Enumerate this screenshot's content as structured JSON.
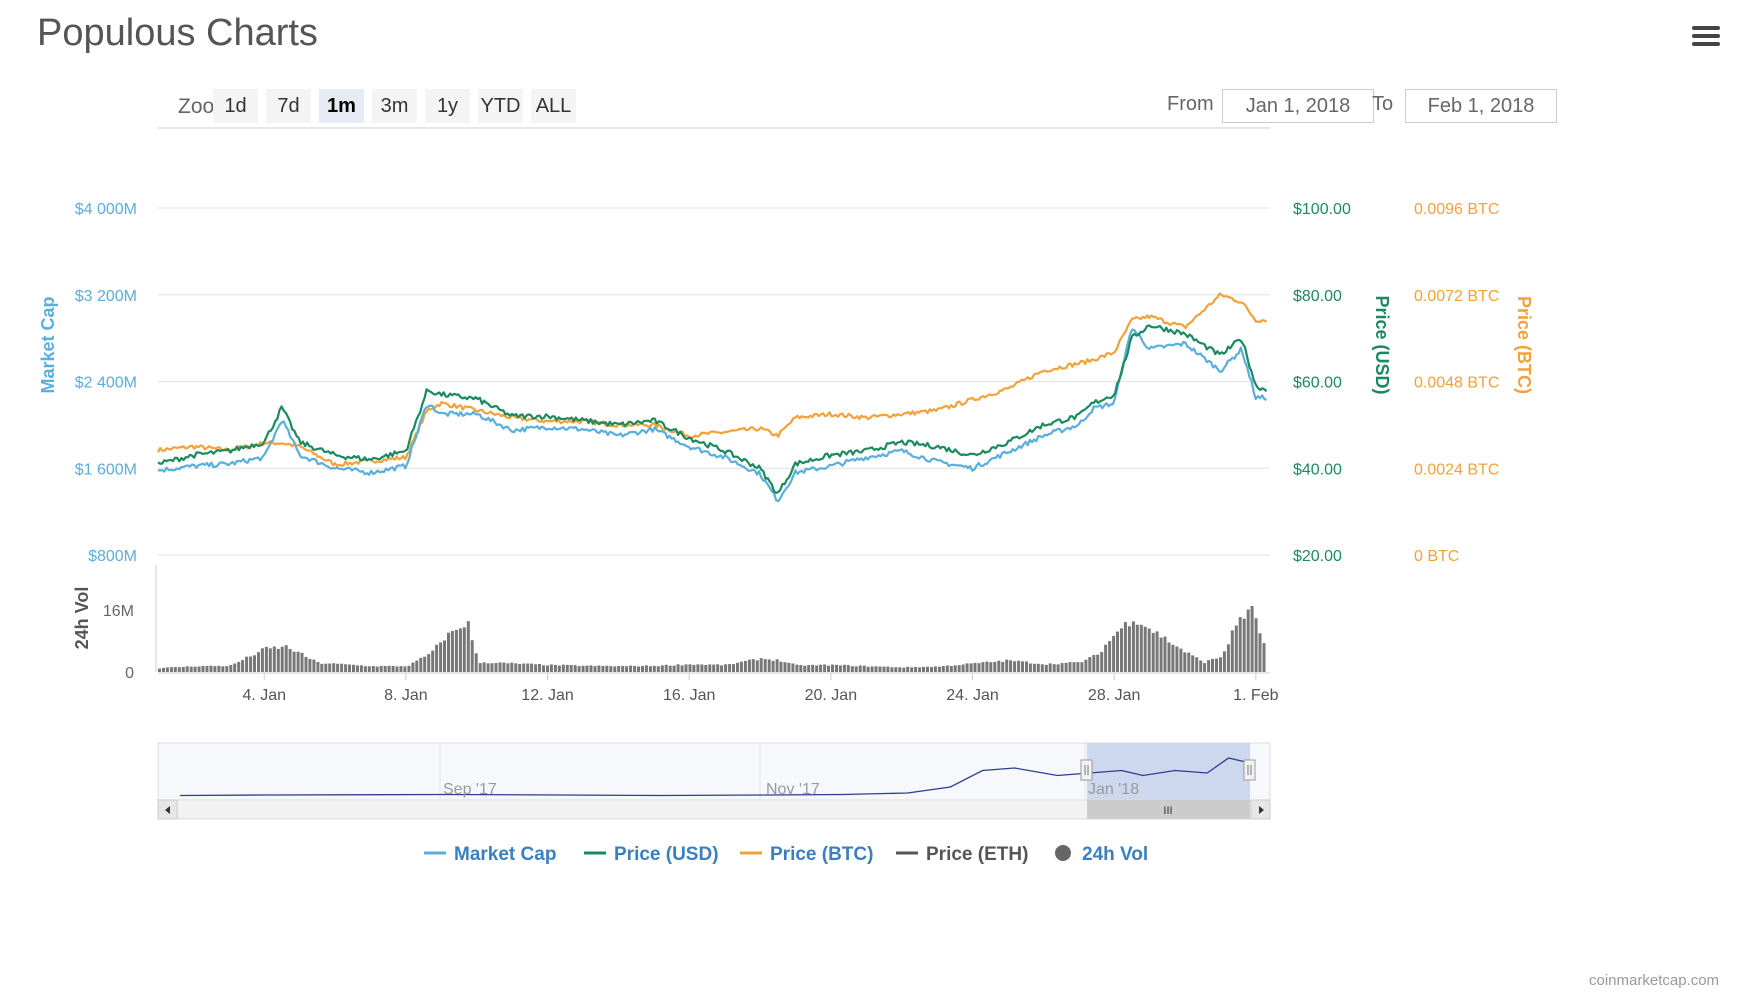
{
  "header": {
    "title": "Populous Charts",
    "menu_icon": "hamburger-icon"
  },
  "zoom": {
    "label": "Zoom",
    "buttons": [
      "1d",
      "7d",
      "1m",
      "3m",
      "1y",
      "YTD",
      "ALL"
    ],
    "active": "1m"
  },
  "range": {
    "from_label": "From",
    "from_value": "Jan 1, 2018",
    "to_label": "To",
    "to_value": "Feb 1, 2018"
  },
  "colors": {
    "market_cap": "#5aaedc",
    "price_usd": "#1b8a5f",
    "price_btc": "#f3a23a",
    "price_eth": "#555555",
    "volume": "#777777",
    "navigator_line": "#2c3e8f",
    "navigator_window": "#c8d3ec"
  },
  "credits": "coinmarketcap.com",
  "chart_data": {
    "type": "line",
    "x_range": [
      "2018-01-01",
      "2018-02-01"
    ],
    "x_ticks": [
      "4. Jan",
      "8. Jan",
      "12. Jan",
      "16. Jan",
      "20. Jan",
      "24. Jan",
      "28. Jan",
      "1. Feb"
    ],
    "x_tick_days": [
      3,
      7,
      11,
      15,
      19,
      23,
      27,
      31
    ],
    "grid": true,
    "legend_placement": "bottom-center",
    "axes": {
      "market_cap": {
        "title": "Market Cap",
        "ylim": [
          800,
          4000
        ],
        "unit": "M USD",
        "ticks": [
          "$800M",
          "$1 600M",
          "$2 400M",
          "$3 200M",
          "$4 000M"
        ]
      },
      "price_usd": {
        "title": "Price (USD)",
        "ylim": [
          20,
          100
        ],
        "ticks": [
          "$20.00",
          "$40.00",
          "$60.00",
          "$80.00",
          "$100.00"
        ]
      },
      "price_btc": {
        "title": "Price (BTC)",
        "ylim": [
          0,
          0.0096
        ],
        "ticks": [
          "0 BTC",
          "0.0024 BTC",
          "0.0048 BTC",
          "0.0072 BTC",
          "0.0096 BTC"
        ]
      },
      "volume": {
        "title": "24h Vol",
        "ylim": [
          0,
          16
        ],
        "unit": "M",
        "ticks": [
          "0",
          "16M"
        ]
      }
    },
    "series": [
      {
        "name": "Market Cap",
        "axis": "market_cap",
        "x": [
          0,
          1,
          2,
          3,
          3.5,
          4,
          5,
          6,
          7,
          7.6,
          8,
          9,
          10,
          11,
          12,
          13,
          14,
          15,
          16,
          17,
          17.5,
          18,
          19,
          20,
          21,
          22,
          23,
          24,
          25,
          26,
          26.4,
          27,
          27.5,
          28,
          29,
          30,
          30.6,
          31,
          31.3
        ],
        "values": [
          1580,
          1620,
          1640,
          1700,
          2050,
          1720,
          1600,
          1560,
          1620,
          2200,
          2100,
          2100,
          1950,
          1980,
          1960,
          1900,
          1960,
          1800,
          1700,
          1550,
          1300,
          1560,
          1620,
          1700,
          1760,
          1660,
          1600,
          1750,
          1900,
          2000,
          2150,
          2200,
          2900,
          2700,
          2750,
          2500,
          2700,
          2250,
          2250
        ]
      },
      {
        "name": "Price (USD)",
        "axis": "price_usd",
        "x": [
          0,
          1,
          2,
          3,
          3.5,
          4,
          5,
          6,
          7,
          7.6,
          8,
          9,
          10,
          11,
          12,
          13,
          14,
          15,
          16,
          17,
          17.5,
          18,
          19,
          20,
          21,
          22,
          23,
          24,
          25,
          26,
          26.4,
          27,
          27.5,
          28,
          29,
          30,
          30.6,
          31,
          31.3
        ],
        "values": [
          41,
          43,
          44,
          46,
          54,
          46,
          43,
          42,
          44,
          58,
          57,
          56,
          52,
          52,
          51,
          50,
          51,
          47,
          44,
          40,
          34,
          41,
          43,
          44,
          46,
          45,
          43,
          46,
          50,
          52,
          55,
          57,
          70,
          73,
          71,
          66,
          70,
          59,
          58
        ]
      },
      {
        "name": "Price (BTC)",
        "axis": "price_btc",
        "x": [
          0,
          1,
          2,
          3,
          3.5,
          4,
          5,
          6,
          7,
          7.6,
          8,
          9,
          10,
          11,
          12,
          13,
          14,
          15,
          16,
          17,
          17.5,
          18,
          19,
          20,
          21,
          22,
          23,
          24,
          25,
          26,
          26.4,
          27,
          27.5,
          28,
          29,
          30,
          30.6,
          31,
          31.3
        ],
        "values": [
          0.0029,
          0.003,
          0.0029,
          0.0031,
          0.0031,
          0.003,
          0.0025,
          0.0026,
          0.0027,
          0.004,
          0.0042,
          0.004,
          0.0038,
          0.0037,
          0.0037,
          0.0036,
          0.0036,
          0.0033,
          0.0034,
          0.0035,
          0.0033,
          0.0038,
          0.0039,
          0.0038,
          0.0039,
          0.004,
          0.0043,
          0.0046,
          0.0051,
          0.0053,
          0.0054,
          0.0056,
          0.0065,
          0.0066,
          0.0063,
          0.0072,
          0.007,
          0.0065,
          0.0065
        ]
      },
      {
        "name": "Price (ETH)",
        "axis": "price_usd",
        "x": [],
        "values": []
      },
      {
        "name": "24h Vol",
        "axis": "volume",
        "type": "bar",
        "x": [
          0,
          1,
          2,
          3,
          3.6,
          4.5,
          5,
          6,
          7,
          7.7,
          8,
          8.7,
          9,
          10,
          11,
          12,
          13,
          14,
          15,
          16,
          17,
          17.5,
          18,
          19,
          20,
          21,
          22,
          23,
          24,
          25,
          26,
          26.5,
          27,
          27.5,
          28,
          29,
          29.5,
          30,
          30.5,
          30.9,
          31.3
        ],
        "values": [
          1.0,
          1.5,
          1.6,
          6.0,
          6.5,
          2.3,
          2.1,
          1.5,
          1.5,
          5.0,
          8.5,
          13.0,
          2.5,
          2.2,
          1.8,
          1.6,
          1.5,
          1.6,
          2.0,
          1.8,
          3.5,
          3.0,
          1.7,
          1.8,
          1.5,
          1.2,
          1.4,
          2.2,
          3.0,
          2.0,
          2.5,
          4.5,
          10.0,
          14.0,
          11.0,
          5.0,
          2.5,
          4.0,
          14.0,
          16.0,
          3.5
        ]
      }
    ],
    "navigator": {
      "x_labels": [
        "Sep '17",
        "Nov '17",
        "Jan '18"
      ],
      "scrollbar_grip": "III"
    }
  }
}
